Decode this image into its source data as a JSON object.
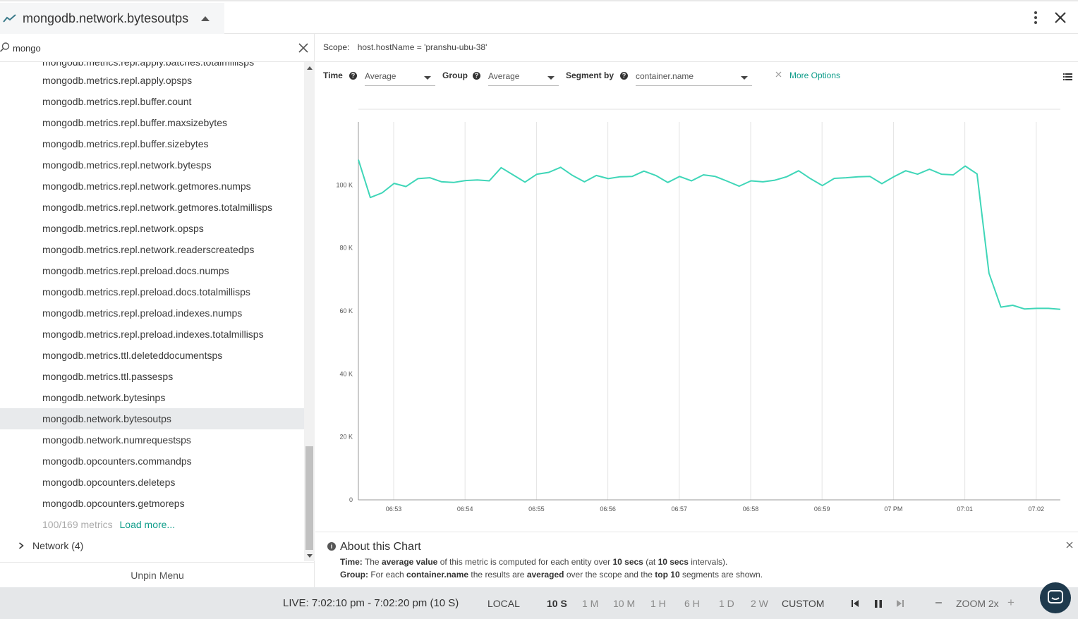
{
  "header": {
    "title": "mongodb.network.bytesoutps",
    "trend_icon": "trend-line-icon",
    "collapse_icon": "caret-up-icon",
    "menu_icon": "kebab-menu-icon",
    "close_icon": "close-icon"
  },
  "search": {
    "value": "mongo",
    "search_icon": "search-icon",
    "clear_icon": "clear-icon"
  },
  "sidebar": {
    "cut_item": "mongodb.metrics.repl.apply.batches.totalmillisps",
    "items": [
      "mongodb.metrics.repl.apply.opsps",
      "mongodb.metrics.repl.buffer.count",
      "mongodb.metrics.repl.buffer.maxsizebytes",
      "mongodb.metrics.repl.buffer.sizebytes",
      "mongodb.metrics.repl.network.bytesps",
      "mongodb.metrics.repl.network.getmores.numps",
      "mongodb.metrics.repl.network.getmores.totalmillisps",
      "mongodb.metrics.repl.network.opsps",
      "mongodb.metrics.repl.network.readerscreatedps",
      "mongodb.metrics.repl.preload.docs.numps",
      "mongodb.metrics.repl.preload.docs.totalmillisps",
      "mongodb.metrics.repl.preload.indexes.numps",
      "mongodb.metrics.repl.preload.indexes.totalmillisps",
      "mongodb.metrics.ttl.deleteddocumentsps",
      "mongodb.metrics.ttl.passesps",
      "mongodb.network.bytesinps",
      "mongodb.network.bytesoutps",
      "mongodb.network.numrequestsps",
      "mongodb.opcounters.commandps",
      "mongodb.opcounters.deleteps",
      "mongodb.opcounters.getmoreps"
    ],
    "selected_index": 16,
    "count_text": "100/169 metrics",
    "load_more": "Load more...",
    "group_label": "Network (4)",
    "unpin": "Unpin Menu"
  },
  "scope": {
    "label": "Scope:",
    "value": "host.hostName = 'pranshu-ubu-38'"
  },
  "controls": {
    "time_label": "Time",
    "time_value": "Average",
    "group_label": "Group",
    "group_value": "Average",
    "segment_label": "Segment by",
    "segment_value": "container.name",
    "more_options": "More Options",
    "help_glyph": "?"
  },
  "chart_data": {
    "type": "line",
    "title": "",
    "xlabel": "",
    "ylabel": "",
    "ylim": [
      0,
      120000
    ],
    "yticks": [
      0,
      20000,
      40000,
      60000,
      80000,
      100000
    ],
    "ytick_labels": [
      "0",
      "20 K",
      "40 K",
      "60 K",
      "80 K",
      "100 K"
    ],
    "xtick_labels": [
      "06:53",
      "06:54",
      "06:55",
      "06:56",
      "06:57",
      "06:58",
      "06:59",
      "07 PM",
      "07:01",
      "07:02"
    ],
    "grid": "vertical",
    "color": "#3fd6b8",
    "series": [
      {
        "values": [
          108000,
          96000,
          97500,
          100500,
          99500,
          102000,
          102300,
          101000,
          100800,
          101400,
          101600,
          101300,
          105500,
          103200,
          100900,
          103400,
          104000,
          105600,
          103000,
          101000,
          103000,
          102000,
          102600,
          102700,
          104400,
          103000,
          100800,
          102700,
          101300,
          103200,
          102700,
          101200,
          99600,
          101300,
          101000,
          101500,
          102600,
          104500,
          102000,
          99800,
          102100,
          102300,
          102600,
          102700,
          100400,
          102600,
          104500,
          103400,
          105000,
          103400,
          103200,
          106000,
          103500,
          72000,
          61200,
          61800,
          60600,
          60800,
          60800,
          60500
        ]
      }
    ]
  },
  "about": {
    "title": "About this Chart",
    "info_glyph": "i",
    "time_label": "Time:",
    "time_text_1": "The",
    "time_bold_1": "average value",
    "time_text_2": "of this metric is computed for each entity over",
    "time_bold_2": "10 secs",
    "time_text_3": "(at",
    "time_bold_3": "10 secs",
    "time_text_4": "intervals).",
    "group_label": "Group:",
    "group_text_1": "For each",
    "group_bold_1": "container.name",
    "group_text_2": "the results are",
    "group_bold_2": "averaged",
    "group_text_3": "over the scope and the",
    "group_bold_3": "top 10",
    "group_text_4": "segments are shown."
  },
  "bottom": {
    "live": "LIVE: 7:02:10 pm - 7:02:20 pm (10 S)",
    "local": "LOCAL",
    "ranges": [
      "10 S",
      "1 M",
      "10 M",
      "1 H",
      "6 H",
      "1 D",
      "2 W",
      "CUSTOM"
    ],
    "active_range": "10 S",
    "minus": "–",
    "zoom": "ZOOM 2x",
    "plus": "+"
  }
}
